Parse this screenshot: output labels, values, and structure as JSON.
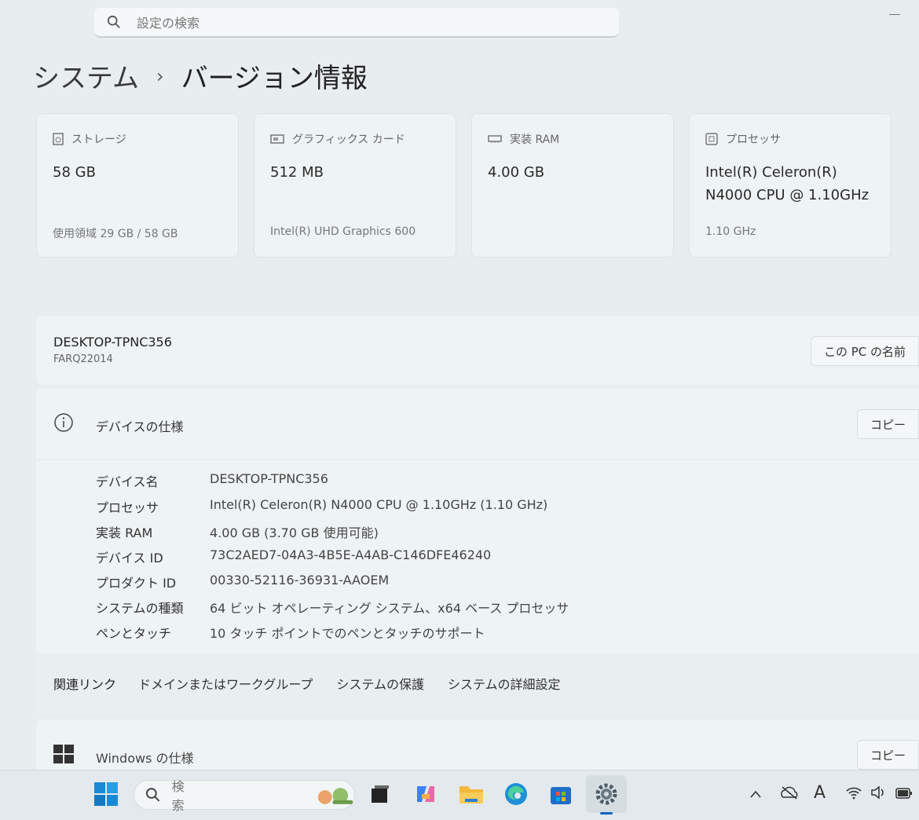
{
  "search": {
    "placeholder": "設定の検索"
  },
  "breadcrumb": {
    "parent": "システム",
    "separator": "›",
    "current": "バージョン情報"
  },
  "cards": [
    {
      "label": "ストレージ",
      "value": "58 GB",
      "sub": "使用領域 29 GB / 58 GB",
      "icon": "storage-icon"
    },
    {
      "label": "グラフィックス カード",
      "value": "512 MB",
      "sub": "Intel(R) UHD Graphics 600",
      "icon": "graphics-card-icon"
    },
    {
      "label": "実装 RAM",
      "value": "4.00 GB",
      "sub": "",
      "icon": "ram-icon"
    },
    {
      "label": "プロセッサ",
      "value_line1": "Intel(R) Celeron(R)",
      "value_line2": "N4000 CPU @ 1.10GHz",
      "sub": "1.10 GHz",
      "icon": "processor-icon"
    }
  ],
  "pc": {
    "name": "DESKTOP-TPNC356",
    "model": "FARQ22014",
    "rename_button": "この PC の名前"
  },
  "device_spec": {
    "title": "デバイスの仕様",
    "copy_button": "コピー",
    "rows": [
      {
        "key": "デバイス名",
        "value": "DESKTOP-TPNC356"
      },
      {
        "key": "プロセッサ",
        "value": "Intel(R) Celeron(R) N4000 CPU @ 1.10GHz (1.10 GHz)"
      },
      {
        "key": "実装 RAM",
        "value": "4.00 GB (3.70 GB 使用可能)"
      },
      {
        "key": "デバイス ID",
        "value": "73C2AED7-04A3-4B5E-A4AB-C146DFE46240"
      },
      {
        "key": "プロダクト ID",
        "value": "00330-52116-36931-AAOEM"
      },
      {
        "key": "システムの種類",
        "value": "64 ビット オペレーティング システム、x64 ベース プロセッサ"
      },
      {
        "key": "ペンとタッチ",
        "value": "10 タッチ ポイントでのペンとタッチのサポート"
      }
    ]
  },
  "related_links": {
    "label": "関連リンク",
    "items": [
      "ドメインまたはワークグループ",
      "システムの保護",
      "システムの詳細設定"
    ]
  },
  "windows_spec": {
    "title": "Windows の仕様",
    "copy_button": "コピー"
  },
  "taskbar": {
    "search_placeholder": "検索",
    "apps": [
      "start-icon",
      "task-view-icon",
      "copilot-icon",
      "file-explorer-icon",
      "edge-icon",
      "store-icon",
      "settings-icon"
    ],
    "tray": [
      "chevron-up-icon",
      "onedrive-icon",
      "ime-icon",
      "wifi-icon",
      "volume-icon",
      "battery-icon"
    ],
    "ime_label": "A",
    "colors": {
      "accent": "#0a66c2",
      "background": "#e8eeef"
    }
  }
}
